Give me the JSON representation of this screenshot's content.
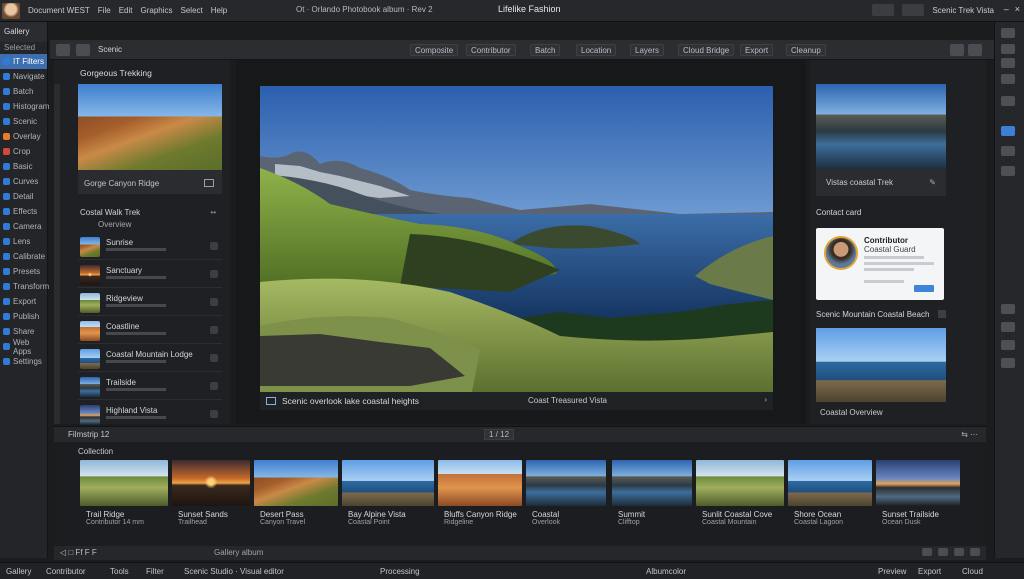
{
  "titlebar": {
    "menu": [
      "Document WEST",
      "File",
      "Edit",
      "Graphics",
      "Select",
      "Help"
    ],
    "document": "Ot · Orlando Photobook album · Rev 2",
    "app_title": "Lifelike Fashion",
    "user": "Scenic Trek Vista",
    "window_controls": [
      "–",
      "×"
    ]
  },
  "toolbar": {
    "title": "Scenic",
    "buttons": [
      "Composite",
      "Contributor",
      "Batch",
      "Location",
      "Layers",
      "Cloud Bridge",
      "Export",
      "Cleanup"
    ]
  },
  "sidebar": {
    "header": "Gallery",
    "subheader": "Selected",
    "items": [
      {
        "label": "IT Filters",
        "color": "#2f7bd8",
        "active": true
      },
      {
        "label": "Navigate",
        "color": "#2f7bd8",
        "active": false
      },
      {
        "label": "Batch",
        "color": "#2f7bd8",
        "active": false
      },
      {
        "label": "Histogram",
        "color": "#2f7bd8",
        "active": false
      },
      {
        "label": "Scenic",
        "color": "#2f7bd8",
        "active": false
      },
      {
        "label": "Overlay",
        "color": "#e57c2a",
        "active": false
      },
      {
        "label": "Crop",
        "color": "#d44a3a",
        "active": false
      },
      {
        "label": "Basic",
        "color": "#2f7bd8",
        "active": false
      },
      {
        "label": "Curves",
        "color": "#2f7bd8",
        "active": false
      },
      {
        "label": "Detail",
        "color": "#2f7bd8",
        "active": false
      },
      {
        "label": "Effects",
        "color": "#2f7bd8",
        "active": false
      },
      {
        "label": "Camera",
        "color": "#2f7bd8",
        "active": false
      },
      {
        "label": "Lens",
        "color": "#2f7bd8",
        "active": false
      },
      {
        "label": "Calibrate",
        "color": "#2f7bd8",
        "active": false
      },
      {
        "label": "Presets",
        "color": "#2f7bd8",
        "active": false
      },
      {
        "label": "Transform",
        "color": "#2f7bd8",
        "active": false
      },
      {
        "label": "Export",
        "color": "#2f7bd8",
        "active": false
      },
      {
        "label": "Publish",
        "color": "#2f7bd8",
        "active": false
      },
      {
        "label": "Share",
        "color": "#2f7bd8",
        "active": false
      },
      {
        "label": "Web Apps",
        "color": "#2f7bd8",
        "active": false
      },
      {
        "label": "Settings",
        "color": "#2f7bd8",
        "active": false
      }
    ]
  },
  "left_panel": {
    "section_title": "Gorgeous Trekking",
    "featured_caption": "Gorge Canyon Ridge",
    "list_title": "Costal Walk Trek",
    "list_more": "••",
    "list_sub": "Overview",
    "rows": [
      "Sunrise",
      "Sanctuary",
      "Ridgeview",
      "Coastline",
      "Coastal Mountain Lodge",
      "Trailside",
      "Highland Vista"
    ]
  },
  "viewer": {
    "caption_left": "Scenic overlook lake coastal heights",
    "caption_right": "Coast Treasured Vista",
    "next": "›"
  },
  "right_panel": {
    "featured_caption": "Vistas coastal Trek",
    "details_title": "Contact card",
    "card": {
      "name": "Contributor",
      "role": "Coastal Guard"
    },
    "sub_title": "Scenic Mountain Coastal Beach",
    "footer": "Coastal Overview"
  },
  "filmstrip": {
    "bar_left": "Filmstrip 12",
    "bar_center": "1 / 12",
    "bar_right": "⇆ ⋯",
    "header": "Collection",
    "tiles": [
      {
        "name": "Trail Ridge",
        "sub": "Contributor 14 mm",
        "scene": "valley"
      },
      {
        "name": "Sunset Sands",
        "sub": "Trailhead",
        "scene": "sunset"
      },
      {
        "name": "Desert Pass",
        "sub": "Canyon Travel",
        "scene": "canyon"
      },
      {
        "name": "Bay Alpine Vista",
        "sub": "Coastal Point",
        "scene": "coast"
      },
      {
        "name": "Bluffs Canyon Ridge",
        "sub": "Ridgeline",
        "scene": "rock"
      },
      {
        "name": "Coastal",
        "sub": "Overlook",
        "scene": "lake"
      },
      {
        "name": "Summit",
        "sub": "Clifftop",
        "scene": "lake"
      },
      {
        "name": "Sunlit Coastal Cove",
        "sub": "Coastal Mountain",
        "scene": "valley"
      },
      {
        "name": "Shore Ocean",
        "sub": "Coastal Lagoon",
        "scene": "coast"
      },
      {
        "name": "Sunset Trailside",
        "sub": "Ocean Dusk",
        "scene": "dusk"
      }
    ]
  },
  "strip_bar": {
    "left": "◁ □ Ff F F",
    "middle": "Gallery album"
  },
  "statusbar": [
    "Gallery",
    "Contributor",
    "Tools",
    "Filter",
    "Scenic Studio · Visual editor",
    "Processing",
    "Albumcolor",
    "Preview",
    "Export",
    "Cloud"
  ]
}
